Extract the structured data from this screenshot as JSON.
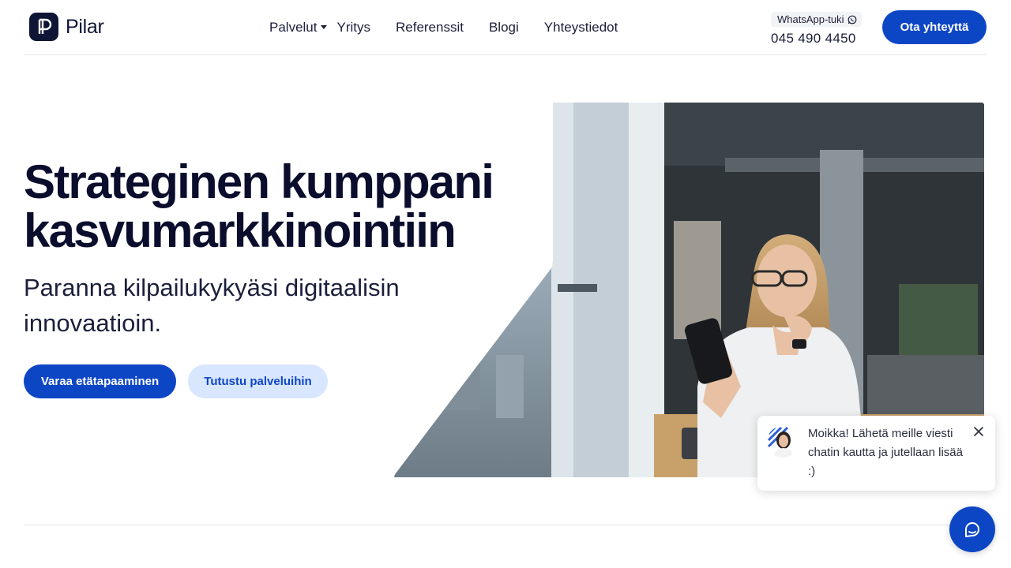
{
  "header": {
    "logo_text": "Pilar",
    "nav": [
      {
        "label": "Palvelut",
        "has_dropdown": true
      },
      {
        "label": "Yritys"
      },
      {
        "label": "Referenssit"
      },
      {
        "label": "Blogi"
      },
      {
        "label": "Yhteystiedot"
      }
    ],
    "whatsapp_label": "WhatsApp-tuki",
    "phone": "045 490 4450",
    "cta_label": "Ota yhteyttä"
  },
  "hero": {
    "title_line1": "Strateginen kumppani",
    "title_line2": "kasvumarkkinointiin",
    "subtitle": "Paranna kilpailukykyäsi digitaalisin innovaatioin.",
    "primary_button": "Varaa etätapaaminen",
    "secondary_button": "Tutustu palveluihin",
    "image_icon": "office-woman-with-phone-photo"
  },
  "chat": {
    "message": "Moikka! Lähetä meille viesti chatin kautta ja jutellaan lisää :)",
    "close_icon": "close-icon",
    "launcher_icon": "chat-bubble-icon"
  },
  "colors": {
    "brand_blue": "#0d46c5",
    "light_blue": "#d9e6ff",
    "navy": "#0a0d2c"
  }
}
